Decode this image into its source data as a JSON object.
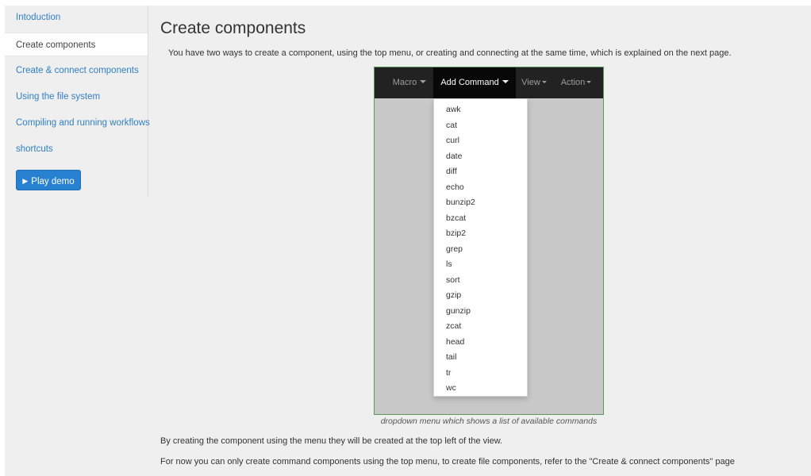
{
  "sidebar": {
    "items": [
      {
        "label": "Intoduction",
        "active": false
      },
      {
        "label": "Create components",
        "active": true
      },
      {
        "label": "Create & connect components",
        "active": false
      },
      {
        "label": "Using the file system",
        "active": false
      },
      {
        "label": "Compiling and running workflows",
        "active": false
      },
      {
        "label": "shortcuts",
        "active": false
      }
    ],
    "play_button": {
      "icon": "play-icon",
      "label": "Play demo"
    }
  },
  "main": {
    "title": "Create components",
    "intro": "You have two ways to create a component, using the top menu, or creating and connecting at the same time, which is explained on the next page.",
    "figure": {
      "menu": {
        "items": [
          "Macro",
          "Add Command",
          "View",
          "Action"
        ],
        "open_item": "Add Command"
      },
      "dropdown_items": [
        "awk",
        "cat",
        "curl",
        "date",
        "diff",
        "echo",
        "bunzip2",
        "bzcat",
        "bzip2",
        "grep",
        "ls",
        "sort",
        "gzip",
        "gunzip",
        "zcat",
        "head",
        "tail",
        "tr",
        "wc"
      ],
      "caption": "dropdown menu which shows a list of available commands"
    },
    "paragraphs": [
      "By creating the component using the menu they will be created at the top left of the view.",
      "For now you can only create command components using the top menu, to create file components, refer to the \"Create & connect components\" page"
    ]
  },
  "colors": {
    "link": "#2f7fc4",
    "button": "#2880d0",
    "navbar": "#222222",
    "figure_border": "#5c9a5c"
  }
}
